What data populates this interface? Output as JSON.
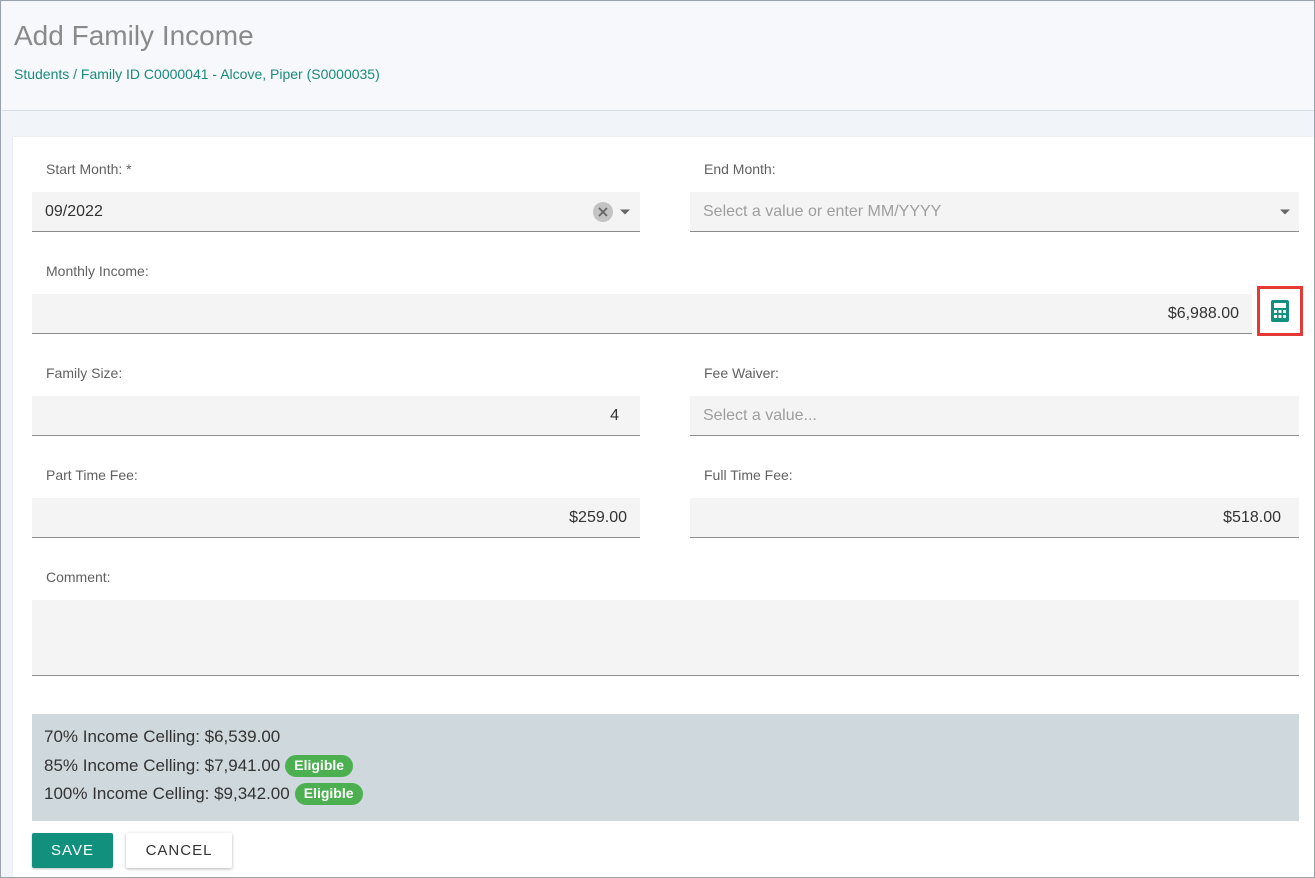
{
  "header": {
    "title": "Add Family Income",
    "breadcrumb": "Students / Family ID C0000041 - Alcove, Piper (S0000035)"
  },
  "form": {
    "start_month": {
      "label": "Start Month: *",
      "value": "09/2022"
    },
    "end_month": {
      "label": "End Month:",
      "placeholder": "Select a value or enter MM/YYYY"
    },
    "monthly_income": {
      "label": "Monthly Income:",
      "value": "$6,988.00"
    },
    "family_size": {
      "label": "Family Size:",
      "value": "4"
    },
    "fee_waiver": {
      "label": "Fee Waiver:",
      "placeholder": "Select a value..."
    },
    "part_time_fee": {
      "label": "Part Time Fee:",
      "value": "$259.00"
    },
    "full_time_fee": {
      "label": "Full Time Fee:",
      "value": "$518.00"
    },
    "comment": {
      "label": "Comment:",
      "value": ""
    }
  },
  "ceilings": [
    {
      "text": "70% Income Celling: $6,539.00",
      "badge": ""
    },
    {
      "text": "85% Income Celling: $7,941.00",
      "badge": "Eligible"
    },
    {
      "text": "100% Income Celling: $9,342.00",
      "badge": "Eligible"
    }
  ],
  "actions": {
    "save_label": "SAVE",
    "cancel_label": "CANCEL"
  },
  "colors": {
    "accent": "#12907e",
    "link": "#1a8a7a",
    "eligible_badge": "#4caf50",
    "highlight_border": "#e53935",
    "ceiling_background": "#cfd8dc"
  },
  "icons": {
    "clear": "clear-circle-icon",
    "dropdown": "caret-down-icon",
    "calculator": "calculator-icon"
  }
}
